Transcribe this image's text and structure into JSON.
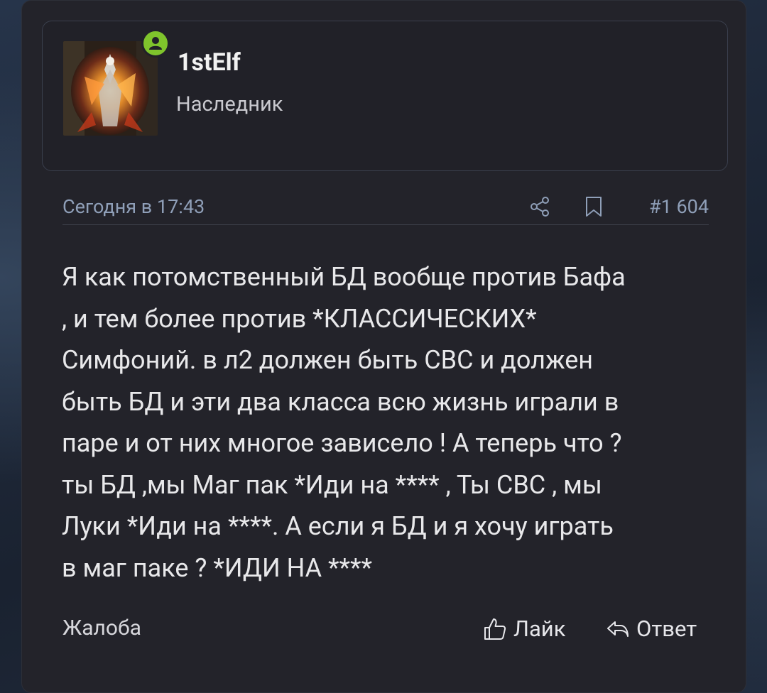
{
  "user": {
    "name": "1stElf",
    "title": "Наследник",
    "online": true
  },
  "meta": {
    "date": "Сегодня в 17:43",
    "post_number": "#1 604"
  },
  "message": "Я как потомственный БД вообще против Бафа\n, и тем более против *КЛАССИЧЕСКИХ*\nСимфоний. в л2 должен быть СВС и должен\nбыть БД и эти два класса всю жизнь играли в\nпаре и от них многое зависело ! А теперь что ?\nты БД ,мы Маг пак *Иди на **** , Ты СВС , мы\nЛуки *Иди на ****. А если я БД и я хочу играть\nв маг паке ? *ИДИ НА ****",
  "footer": {
    "report_label": "Жалоба",
    "like_label": "Лайк",
    "reply_label": "Ответ"
  },
  "icons": [
    "user-online-icon",
    "share-icon",
    "bookmark-icon",
    "thumbs-up-icon",
    "reply-icon"
  ],
  "colors": {
    "online": "#7fc42c",
    "meta_text": "#8f9fb8",
    "card_bg": "#23232a"
  }
}
